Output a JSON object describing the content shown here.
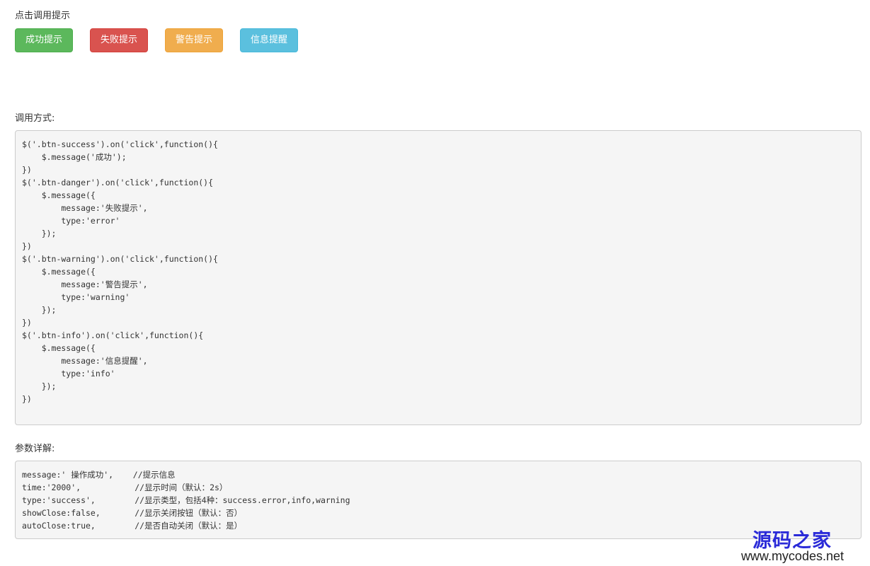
{
  "sections": {
    "click_title": "点击调用提示",
    "usage_title": "调用方式:",
    "params_title": "参数详解:"
  },
  "buttons": [
    {
      "label": "成功提示",
      "color": "#5cb85c",
      "border": "#4cae4c"
    },
    {
      "label": "失败提示",
      "color": "#d9534f",
      "border": "#d43f3a"
    },
    {
      "label": "警告提示",
      "color": "#f0ad4e",
      "border": "#eea236"
    },
    {
      "label": "信息提醒",
      "color": "#5bc0de",
      "border": "#46b8da"
    }
  ],
  "code": {
    "usage": "$('.btn-success').on('click',function(){\n    $.message('成功');\n})\n$('.btn-danger').on('click',function(){\n    $.message({\n        message:'失败提示',\n        type:'error'\n    });\n})\n$('.btn-warning').on('click',function(){\n    $.message({\n        message:'警告提示',\n        type:'warning'\n    });\n})\n$('.btn-info').on('click',function(){\n    $.message({\n        message:'信息提醒',\n        type:'info'\n    });\n})",
    "params": "message:' 操作成功',    //提示信息\ntime:'2000',           //显示时间（默认：2s）\ntype:'success',        //显示类型，包括4种：success.error,info,warning\nshowClose:false,       //显示关闭按钮（默认：否）\nautoClose:true,        //是否自动关闭（默认：是）"
  },
  "watermark": {
    "brand": "源码之家",
    "url": "www.mycodes.net"
  }
}
